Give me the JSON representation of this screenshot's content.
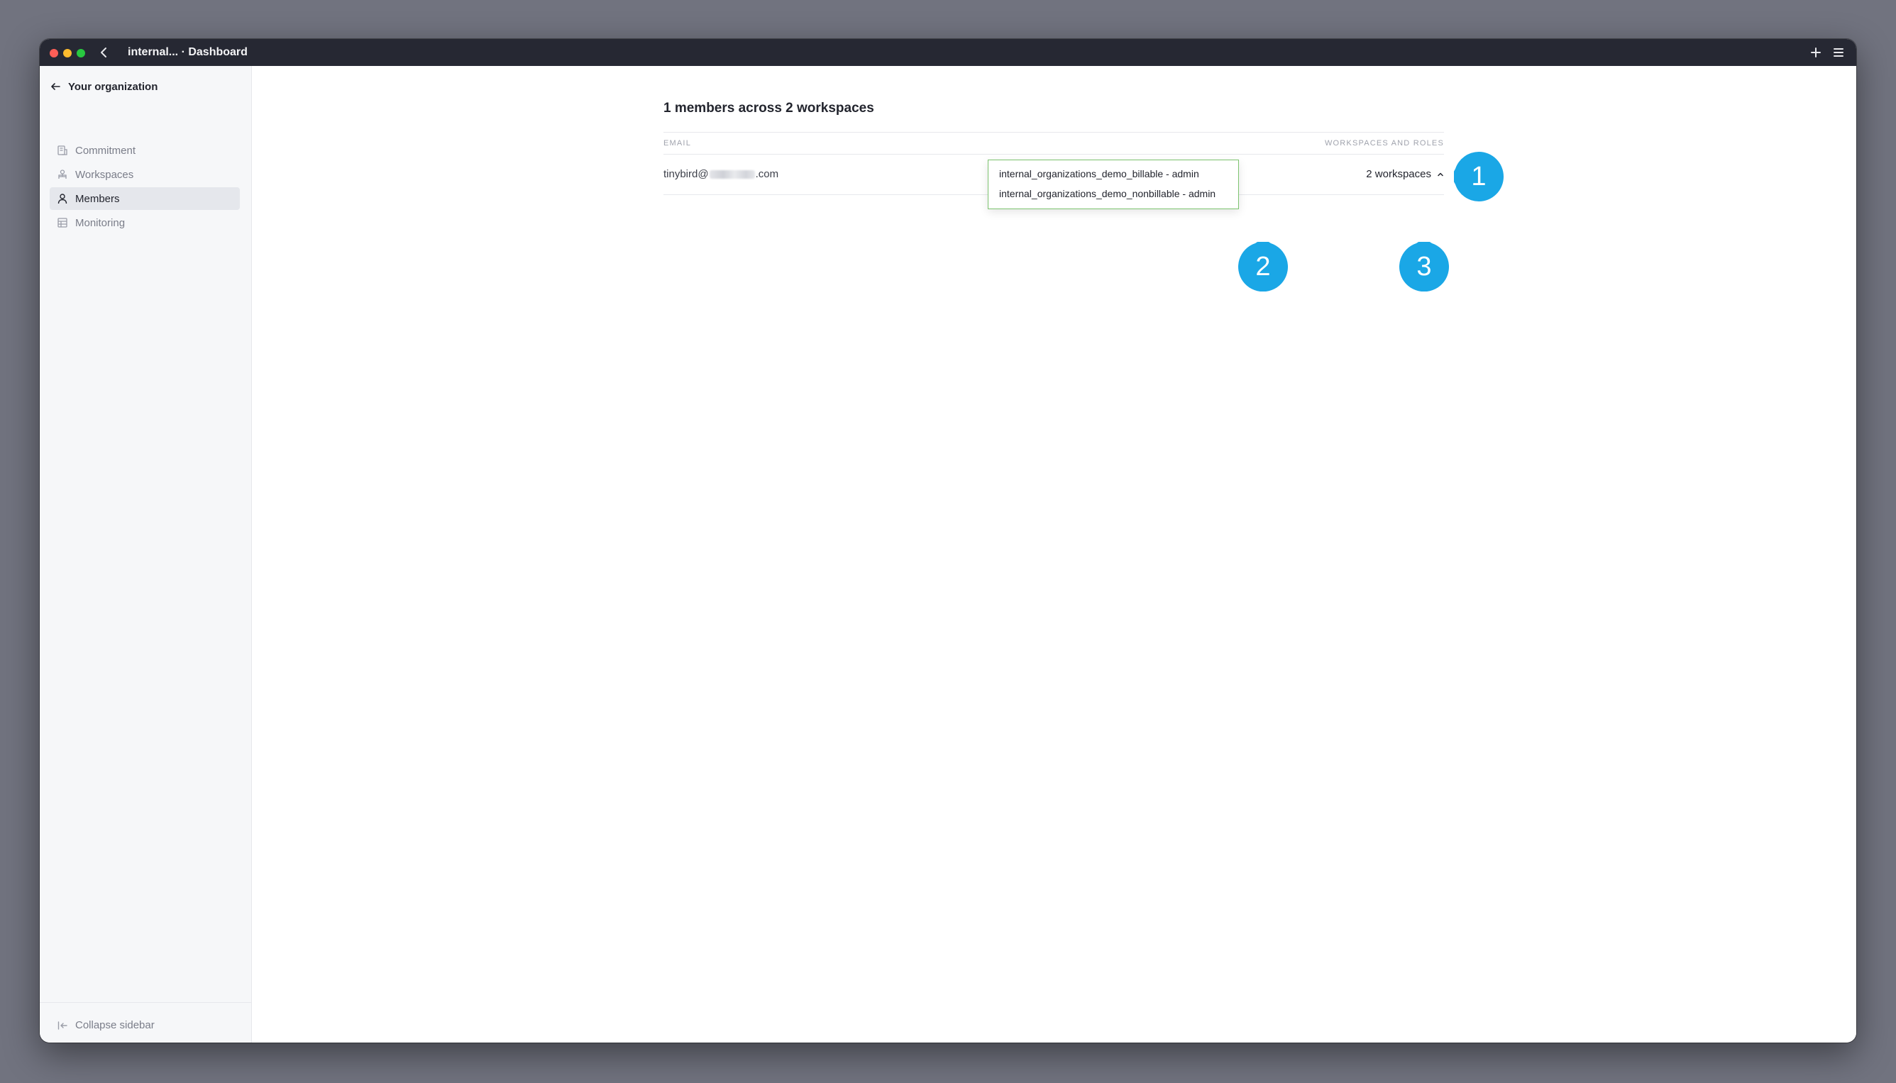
{
  "window": {
    "title": "internal... · Dashboard"
  },
  "sidebar": {
    "header": "Your organization",
    "items": [
      {
        "label": "Commitment",
        "icon": "commitment-icon",
        "active": false
      },
      {
        "label": "Workspaces",
        "icon": "workspaces-icon",
        "active": false
      },
      {
        "label": "Members",
        "icon": "user-icon",
        "active": true
      },
      {
        "label": "Monitoring",
        "icon": "monitoring-icon",
        "active": false
      }
    ],
    "collapse_label": "Collapse sidebar"
  },
  "main": {
    "title": "1 members across 2 workspaces",
    "table": {
      "columns": [
        "EMAIL",
        "WORKSPACES AND ROLES"
      ],
      "rows": [
        {
          "email_prefix": "tinybird@",
          "email_suffix": ".com",
          "workspaces_label": "2 workspaces"
        }
      ]
    },
    "dropdown": {
      "items": [
        "internal_organizations_demo_billable - admin",
        "internal_organizations_demo_nonbillable - admin"
      ]
    }
  },
  "annotations": [
    "1",
    "2",
    "3"
  ],
  "colors": {
    "titlebar": "#262833",
    "marker": "#1aa7e6",
    "dropdown_border": "#7cc36e",
    "sidebar_bg": "#f6f7f9",
    "desktop_bg": "#71737f"
  }
}
